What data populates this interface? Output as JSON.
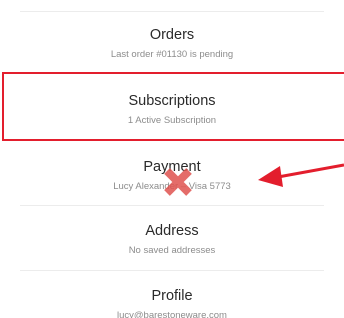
{
  "menu": {
    "orders": {
      "title": "Orders",
      "subtitle": "Last order #01130 is pending"
    },
    "subscriptions": {
      "title": "Subscriptions",
      "subtitle": "1 Active Subscription"
    },
    "payment": {
      "title": "Payment",
      "subtitle": "Lucy Alexander – Visa 5773"
    },
    "address": {
      "title": "Address",
      "subtitle": "No saved addresses"
    },
    "profile": {
      "title": "Profile",
      "subtitle": "lucy@barestoneware.com"
    }
  },
  "annotations": {
    "highlight_color": "#e31e2d",
    "cross_color": "#e0534f",
    "arrow_color": "#e31e2d",
    "highlight_target": "subscriptions",
    "crossed_target": "payment",
    "arrow_target": "payment"
  }
}
